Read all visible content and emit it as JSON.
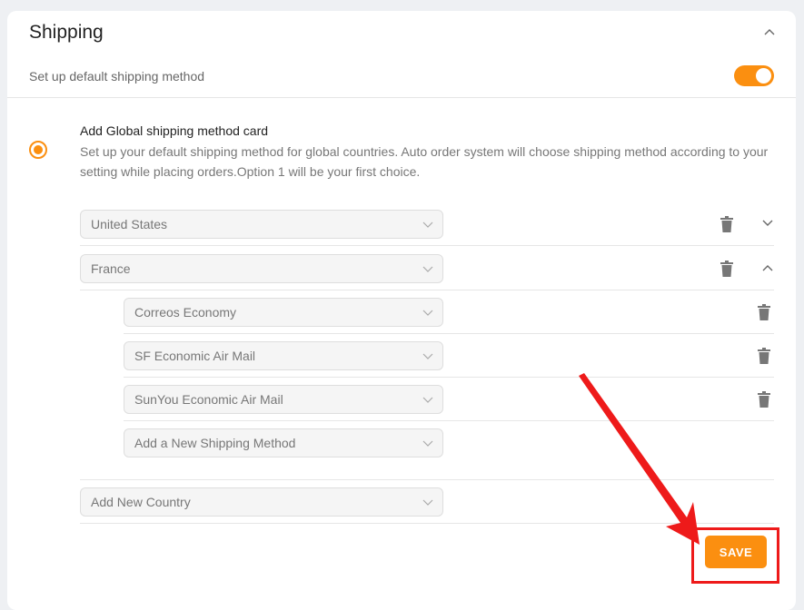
{
  "panel": {
    "title": "Shipping",
    "default_label": "Set up default shipping method",
    "default_enabled": true
  },
  "global_card": {
    "title": "Add Global shipping method card",
    "description": "Set up your default shipping method for global countries. Auto order system will choose shipping method according to your setting while placing orders.Option 1 will be your first choice.",
    "selected": true
  },
  "countries": [
    {
      "name": "United States",
      "expanded": false
    },
    {
      "name": "France",
      "expanded": true,
      "methods": [
        "Correos Economy",
        "SF Economic Air Mail",
        "SunYou Economic Air Mail"
      ],
      "add_method_placeholder": "Add a New Shipping Method"
    }
  ],
  "add_country_placeholder": "Add New Country",
  "save_label": "SAVE",
  "colors": {
    "accent": "#fb8f10",
    "highlight": "#ee1a1a"
  },
  "icons": {
    "collapse": "chevron-up-icon",
    "expand": "chevron-down-icon",
    "delete": "trash-icon",
    "select_caret": "chevron-down-icon"
  }
}
